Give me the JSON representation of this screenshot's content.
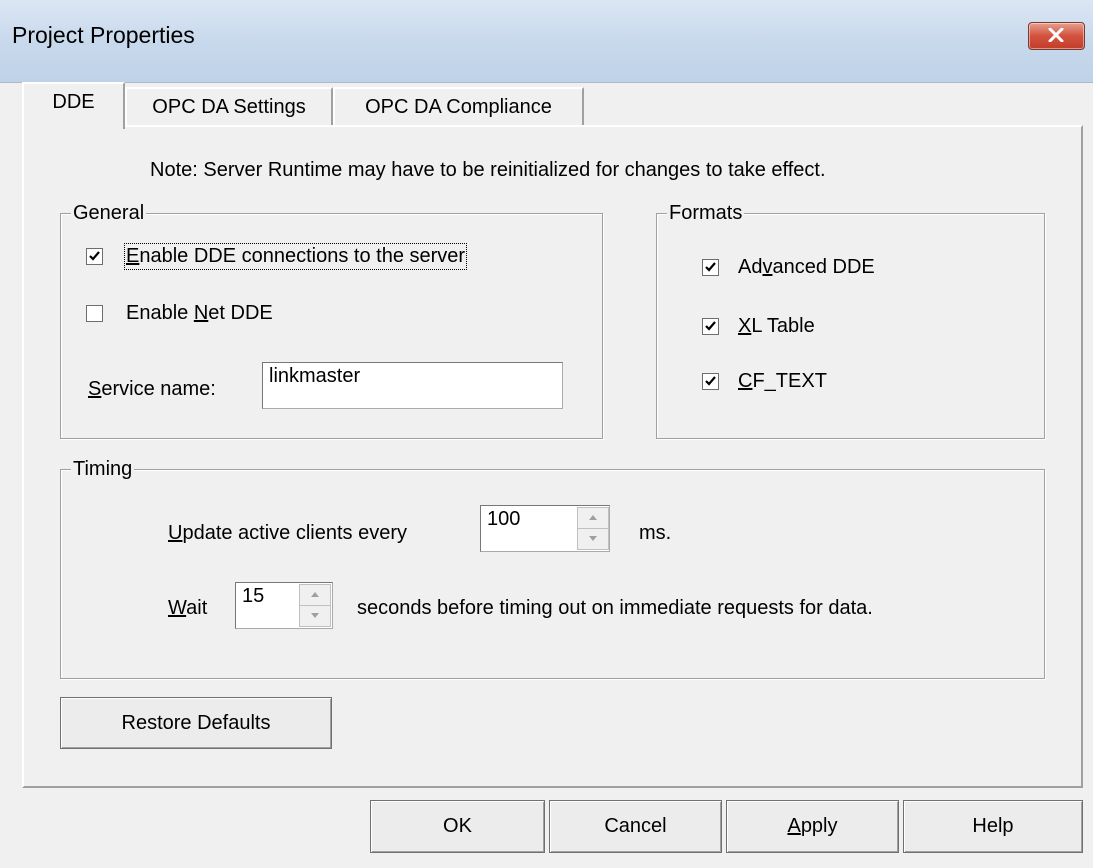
{
  "window": {
    "title": "Project Properties"
  },
  "tabs": [
    "DDE",
    "OPC DA Settings",
    "OPC DA Compliance"
  ],
  "note": "Note: Server Runtime may have to be reinitialized for changes to take effect.",
  "general": {
    "title": "General",
    "enable_dde": {
      "pre": "",
      "mnemonic": "E",
      "post": "nable DDE connections to the server",
      "checked": true
    },
    "enable_net_dde": {
      "pre": "Enable ",
      "mnemonic": "N",
      "post": "et DDE",
      "checked": false
    },
    "service_name": {
      "mnemonic": "S",
      "post": "ervice name:",
      "value": "linkmaster"
    }
  },
  "formats": {
    "title": "Formats",
    "advanced_dde": {
      "pre": "Ad",
      "mnemonic": "v",
      "post": "anced DDE",
      "checked": true
    },
    "xl_table": {
      "pre": "",
      "mnemonic": "X",
      "post": "L Table",
      "checked": true
    },
    "cf_text": {
      "pre": "",
      "mnemonic": "C",
      "post": "F_TEXT",
      "checked": true
    }
  },
  "timing": {
    "title": "Timing",
    "update": {
      "mnemonic": "U",
      "post": "pdate active clients every",
      "value": "100",
      "unit": "ms."
    },
    "wait": {
      "mnemonic": "W",
      "post": "ait",
      "value": "15",
      "suffix": "seconds before timing out on immediate requests for data."
    }
  },
  "restore_defaults": "Restore Defaults",
  "buttons": {
    "ok": "OK",
    "cancel": "Cancel",
    "apply": {
      "pre": "",
      "mnemonic": "A",
      "post": "pply"
    },
    "help": "Help"
  }
}
